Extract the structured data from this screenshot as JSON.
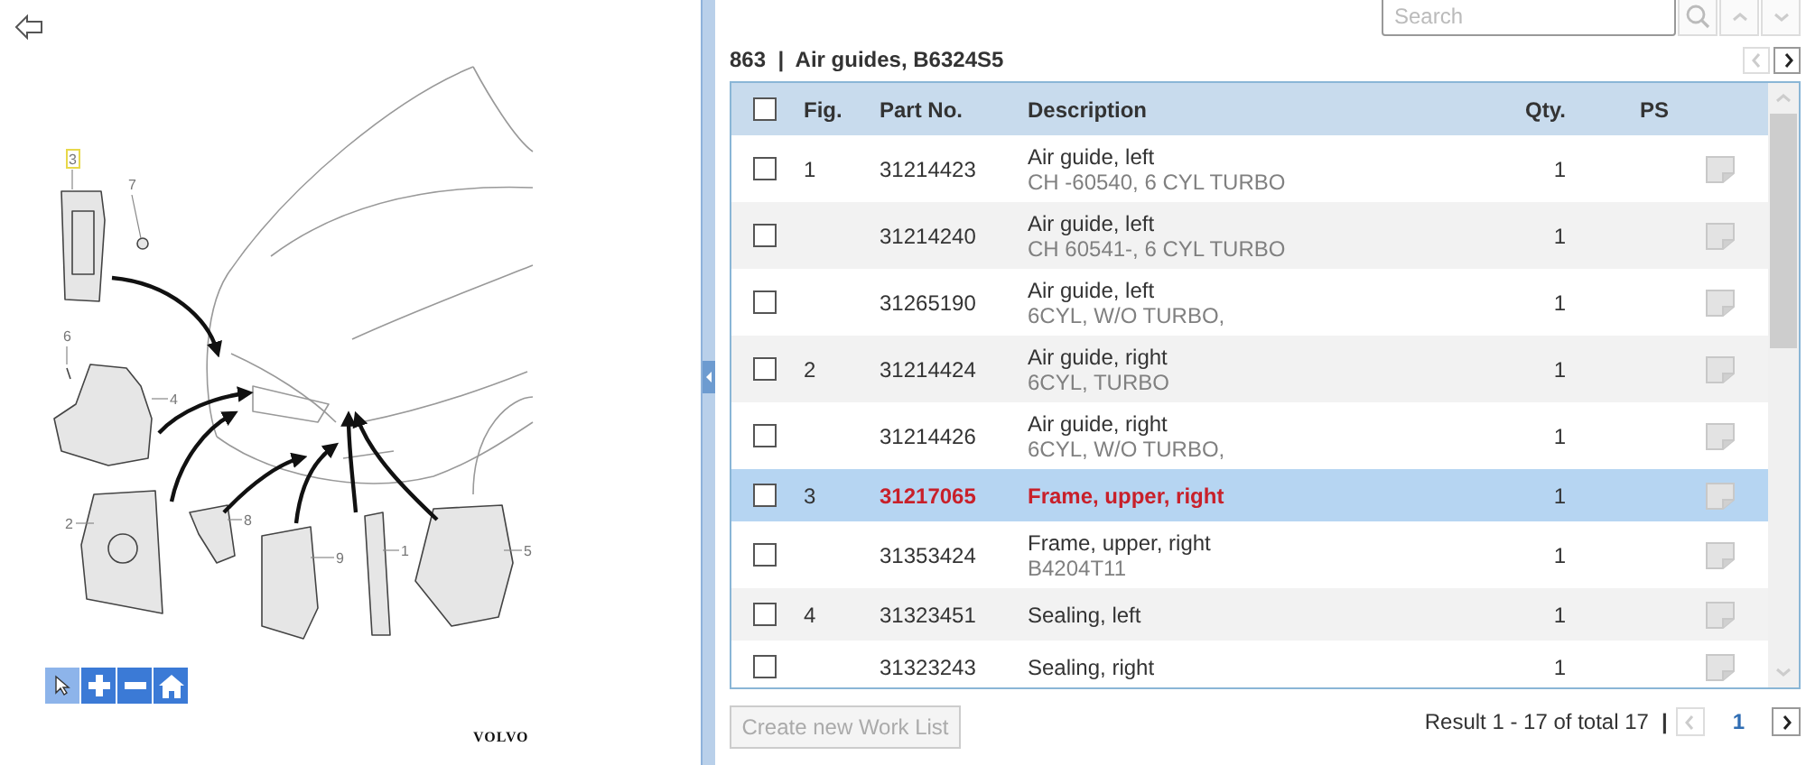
{
  "diagram": {
    "callouts": [
      {
        "label": "3",
        "selected": true
      },
      {
        "label": "7",
        "selected": false
      },
      {
        "label": "6",
        "selected": false
      },
      {
        "label": "4",
        "selected": false
      },
      {
        "label": "2",
        "selected": false
      },
      {
        "label": "8",
        "selected": false
      },
      {
        "label": "9",
        "selected": false
      },
      {
        "label": "1",
        "selected": false
      },
      {
        "label": "5",
        "selected": false
      }
    ],
    "tools": [
      {
        "kind": "pointer",
        "selected": true
      },
      {
        "kind": "zoom_in",
        "selected": false
      },
      {
        "kind": "zoom_out",
        "selected": false
      },
      {
        "kind": "home",
        "selected": false
      }
    ],
    "logo": "VOLVO"
  },
  "search": {
    "placeholder": "Search"
  },
  "title": {
    "number": "863",
    "separator": "|",
    "name": "Air guides, B6324S5"
  },
  "group_nav": {
    "prev_disabled": true,
    "next_disabled": false
  },
  "table": {
    "columns": [
      "Fig.",
      "Part No.",
      "Description",
      "Qty.",
      "PS"
    ],
    "header_checked": false,
    "rows": [
      {
        "fig": "1",
        "part_no": "31214423",
        "description": "Air guide, left",
        "note": "CH -60540, 6 CYL TURBO",
        "qty": "1",
        "checked": false,
        "selected": false
      },
      {
        "fig": "",
        "part_no": "31214240",
        "description": "Air guide, left",
        "note": "CH 60541-, 6 CYL TURBO",
        "qty": "1",
        "checked": false,
        "selected": false
      },
      {
        "fig": "",
        "part_no": "31265190",
        "description": "Air guide, left",
        "note": "6CYL, W/O TURBO,",
        "qty": "1",
        "checked": false,
        "selected": false
      },
      {
        "fig": "2",
        "part_no": "31214424",
        "description": "Air guide, right",
        "note": "6CYL, TURBO",
        "qty": "1",
        "checked": false,
        "selected": false
      },
      {
        "fig": "",
        "part_no": "31214426",
        "description": "Air guide, right",
        "note": "6CYL, W/O TURBO,",
        "qty": "1",
        "checked": false,
        "selected": false
      },
      {
        "fig": "3",
        "part_no": "31217065",
        "description": "Frame, upper, right",
        "note": "",
        "qty": "1",
        "checked": false,
        "selected": true
      },
      {
        "fig": "",
        "part_no": "31353424",
        "description": "Frame, upper, right",
        "note": "B4204T11",
        "qty": "1",
        "checked": false,
        "selected": false
      },
      {
        "fig": "4",
        "part_no": "31323451",
        "description": "Sealing, left",
        "note": "",
        "qty": "1",
        "checked": false,
        "selected": false
      },
      {
        "fig": "",
        "part_no": "31323243",
        "description": "Sealing, right",
        "note": "",
        "qty": "1",
        "checked": false,
        "selected": false
      }
    ]
  },
  "footer": {
    "create_button": {
      "label": "Create new Work List",
      "disabled": true
    },
    "result": "Result 1 - 17 of total 17",
    "separator": "|",
    "page": "1",
    "prev_disabled": true,
    "next_disabled": false
  }
}
